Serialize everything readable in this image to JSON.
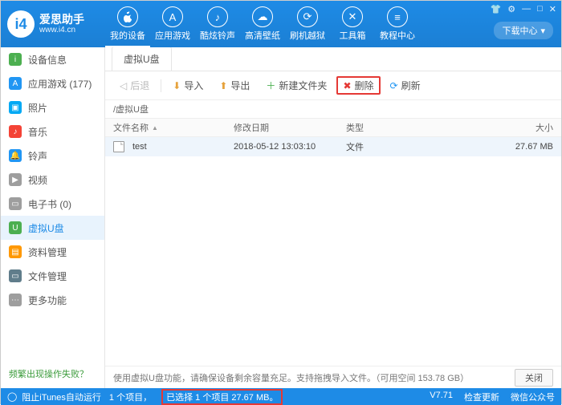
{
  "app": {
    "title": "爱思助手",
    "url": "www.i4.cn",
    "download_center": "下载中心"
  },
  "window_controls": {
    "settings": "⚙",
    "skin": "👕",
    "min": "—",
    "max": "□",
    "close": "✕"
  },
  "top_nav": [
    {
      "label": "我的设备",
      "glyph": ""
    },
    {
      "label": "应用游戏",
      "glyph": "A"
    },
    {
      "label": "酷炫铃声",
      "glyph": "♪"
    },
    {
      "label": "高清壁纸",
      "glyph": "☁"
    },
    {
      "label": "刷机越狱",
      "glyph": "⟳"
    },
    {
      "label": "工具箱",
      "glyph": "✕"
    },
    {
      "label": "教程中心",
      "glyph": "≡"
    }
  ],
  "sidebar": {
    "items": [
      {
        "label": "设备信息",
        "color": "#4caf50",
        "glyph": "i"
      },
      {
        "label": "应用游戏",
        "count": "(177)",
        "color": "#2196f3",
        "glyph": "A"
      },
      {
        "label": "照片",
        "color": "#03a9f4",
        "glyph": "▣"
      },
      {
        "label": "音乐",
        "color": "#f44336",
        "glyph": "♪"
      },
      {
        "label": "铃声",
        "color": "#2196f3",
        "glyph": "🔔"
      },
      {
        "label": "视频",
        "color": "#9e9e9e",
        "glyph": "▶"
      },
      {
        "label": "电子书",
        "count": "(0)",
        "color": "#9e9e9e",
        "glyph": "▭"
      },
      {
        "label": "虚拟U盘",
        "color": "#4caf50",
        "glyph": "U"
      },
      {
        "label": "资料管理",
        "color": "#ff9800",
        "glyph": "▤"
      },
      {
        "label": "文件管理",
        "color": "#607d8b",
        "glyph": "▭"
      },
      {
        "label": "更多功能",
        "color": "#9e9e9e",
        "glyph": "⋯"
      }
    ],
    "footer_link": "频繁出现操作失败？"
  },
  "tabs": [
    {
      "label": "虚拟U盘"
    }
  ],
  "toolbar": {
    "back": "后退",
    "import": "导入",
    "export": "导出",
    "new_folder": "新建文件夹",
    "delete": "删除",
    "refresh": "刷新"
  },
  "breadcrumb": "/虚拟U盘",
  "columns": {
    "name": "文件名称",
    "date": "修改日期",
    "type": "类型",
    "size": "大小"
  },
  "rows": [
    {
      "name": "test",
      "date": "2018-05-12 13:03:10",
      "type": "文件",
      "size": "27.67 MB"
    }
  ],
  "hint": "使用虚拟U盘功能，请确保设备剩余容量充足。支持拖拽导入文件。（可用空间 153.78 GB）",
  "close_label": "关闭",
  "status": {
    "itunes": "阻止iTunes自动运行",
    "count": "1 个项目，",
    "selected": "已选择 1 个项目 27.67 MB。",
    "version": "V7.71",
    "check_update": "检查更新",
    "wechat": "微信公众号"
  }
}
